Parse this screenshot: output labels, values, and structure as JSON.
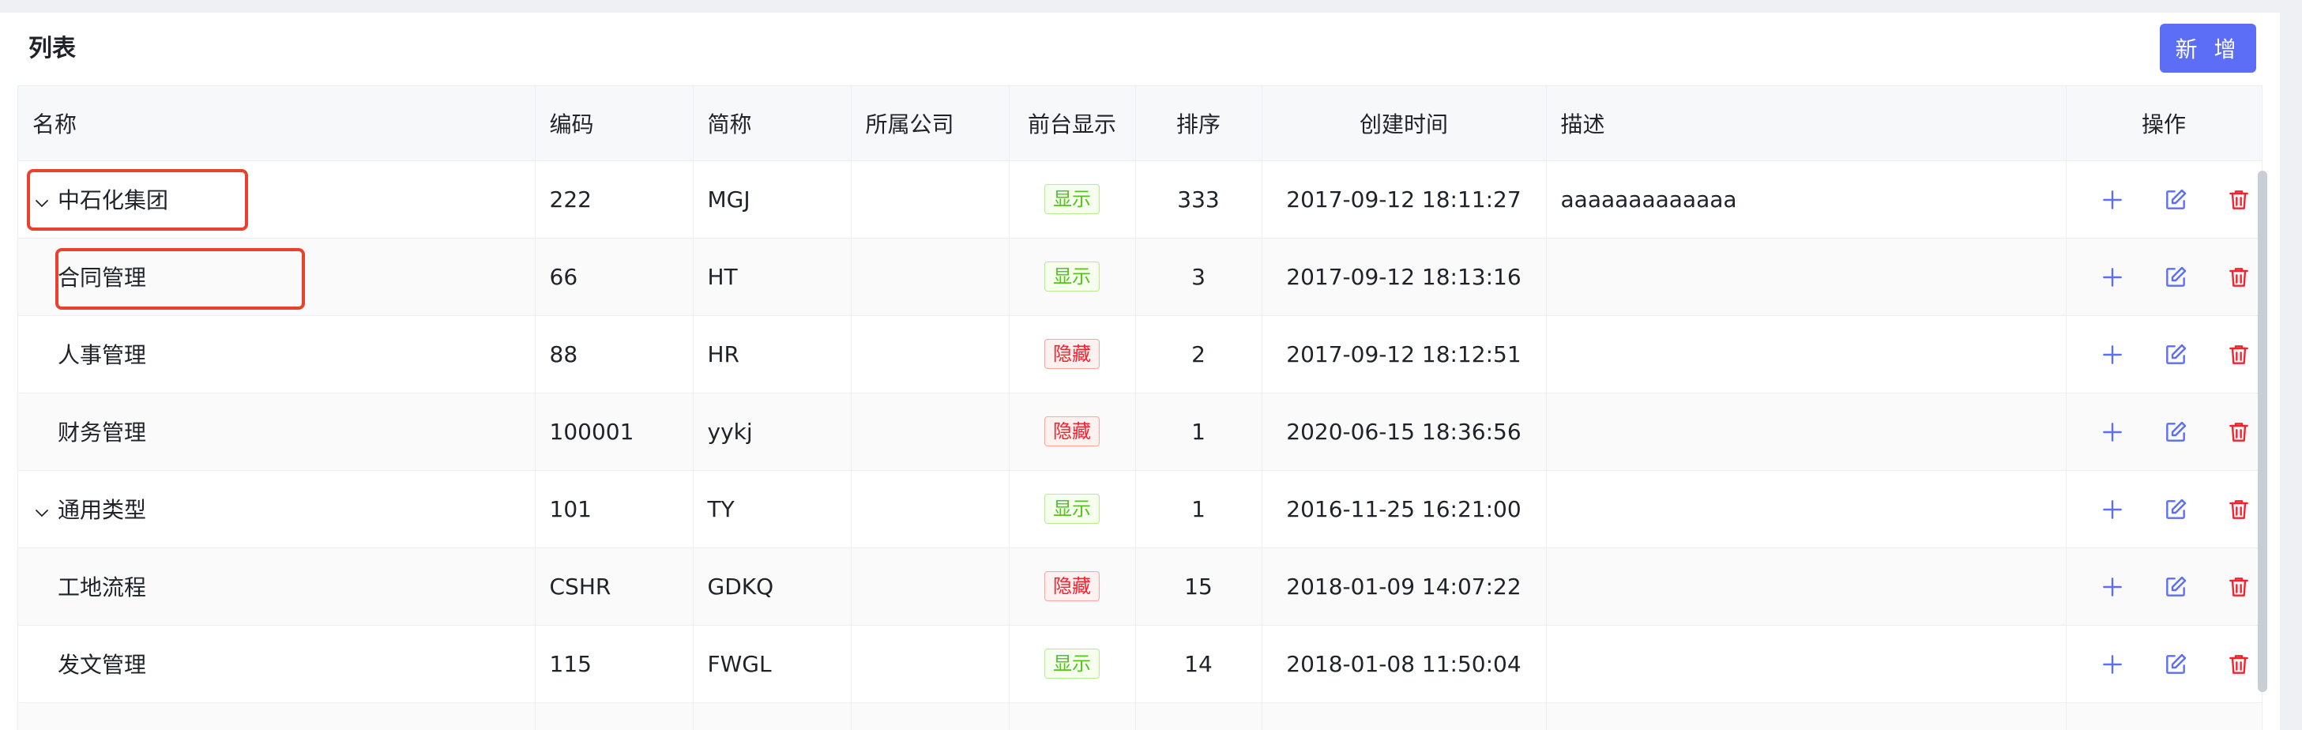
{
  "header": {
    "title": "列表",
    "add_label": "新 增"
  },
  "columns": {
    "name": "名称",
    "code": "编码",
    "short": "简称",
    "company": "所属公司",
    "display": "前台显示",
    "order": "排序",
    "created": "创建时间",
    "desc": "描述",
    "ops": "操作"
  },
  "rows": [
    {
      "name": "中石化集团",
      "code": "222",
      "short": "MGJ",
      "company": "",
      "status": "显示",
      "status_type": "show",
      "order": "333",
      "created": "2017-09-12 18:11:27",
      "desc": "aaaaaaaaaaaaa",
      "expandable": true
    },
    {
      "name": "合同管理",
      "code": "66",
      "short": "HT",
      "company": "",
      "status": "显示",
      "status_type": "show",
      "order": "3",
      "created": "2017-09-12 18:13:16",
      "desc": "",
      "expandable": false
    },
    {
      "name": "人事管理",
      "code": "88",
      "short": "HR",
      "company": "",
      "status": "隐藏",
      "status_type": "hide",
      "order": "2",
      "created": "2017-09-12 18:12:51",
      "desc": "",
      "expandable": false
    },
    {
      "name": "财务管理",
      "code": "100001",
      "short": "yykj",
      "company": "",
      "status": "隐藏",
      "status_type": "hide",
      "order": "1",
      "created": "2020-06-15 18:36:56",
      "desc": "",
      "expandable": false
    },
    {
      "name": "通用类型",
      "code": "101",
      "short": "TY",
      "company": "",
      "status": "显示",
      "status_type": "show",
      "order": "1",
      "created": "2016-11-25 16:21:00",
      "desc": "",
      "expandable": true
    },
    {
      "name": "工地流程",
      "code": "CSHR",
      "short": "GDKQ",
      "company": "",
      "status": "隐藏",
      "status_type": "hide",
      "order": "15",
      "created": "2018-01-09 14:07:22",
      "desc": "",
      "expandable": false
    },
    {
      "name": "发文管理",
      "code": "115",
      "short": "FWGL",
      "company": "",
      "status": "显示",
      "status_type": "show",
      "order": "14",
      "created": "2018-01-08 11:50:04",
      "desc": "",
      "expandable": false
    }
  ],
  "colors": {
    "accent": "#5b6ef5",
    "show": "#52c41a",
    "hide": "#f5222d",
    "highlight": "#e8412d",
    "delete": "#f5222d"
  },
  "icons": {
    "expand": "chevron-down-icon",
    "add": "plus-icon",
    "edit": "edit-icon",
    "delete": "trash-icon"
  }
}
